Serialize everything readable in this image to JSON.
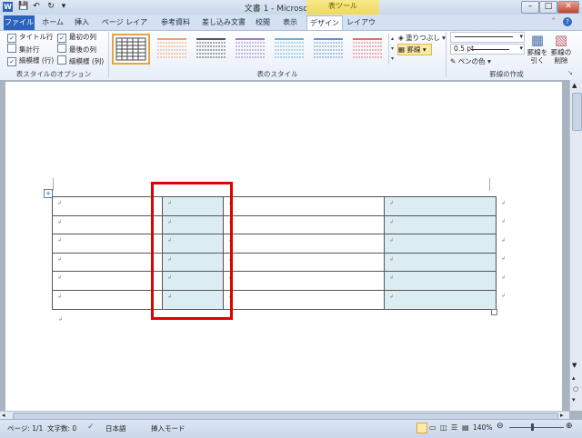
{
  "window": {
    "title": "文書 1 - Microsoft Word",
    "context_tab_group": "表ツール",
    "min_glyph": "–",
    "max_glyph": "□",
    "close_glyph": "✕"
  },
  "qat": {
    "app": "W",
    "save": "💾",
    "undo": "↶",
    "redo": "↻",
    "more": "▾"
  },
  "tabs": [
    "ファイル",
    "ホーム",
    "挿入",
    "ページ レイアウト",
    "参考資料",
    "差し込み文書",
    "校閲",
    "表示",
    "デザイン",
    "レイアウト"
  ],
  "ribbon": {
    "style_options": {
      "header_row": "タイトル行",
      "total_row": "集計行",
      "banded_rows": "縞模様 (行)",
      "first_column": "最初の列",
      "last_column": "最後の列",
      "banded_columns": "縞模様 (列)",
      "group_label": "表スタイルのオプション"
    },
    "styles": {
      "group_label": "表のスタイル",
      "shading": "塗りつぶし",
      "borders": "罫線"
    },
    "draw": {
      "pen_weight": "0.5 pt",
      "pen_color": "ペンの色",
      "draw_table_line1": "罫線を",
      "draw_table_line2": "引く",
      "eraser_line1": "罫線の",
      "eraser_line2": "削除",
      "group_label": "罫線の作成"
    },
    "style_colors": [
      "#444444",
      "#f0a070",
      "#555555",
      "#9a7cc0",
      "#6ab0d8",
      "#6a8ed0",
      "#e07070"
    ]
  },
  "table": {
    "paragraph_mark": "↲",
    "rows": 6,
    "cols": 4,
    "shaded_columns": [
      1,
      3
    ],
    "shade_color": "#dbedf3"
  },
  "highlight_color": "#e00000",
  "status": {
    "page": "ページ: 1/1",
    "words": "文字数: 0",
    "language": "日本語",
    "mode": "挿入モード",
    "zoom": "140%"
  }
}
